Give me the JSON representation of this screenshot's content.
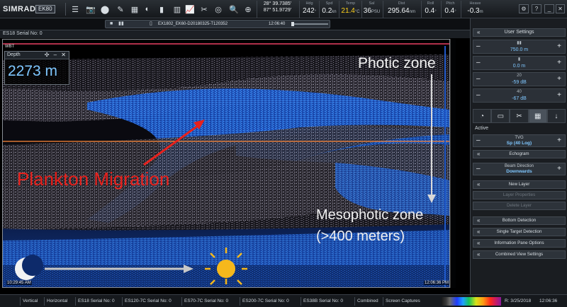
{
  "app": {
    "brand": "SIMRAD",
    "model": "EK80"
  },
  "toolbar": {
    "icons": [
      "camera-icon",
      "record-icon",
      "pen-icon",
      "palette-icon",
      "gauge-icon",
      "bar-chart-icon",
      "graph-icon",
      "tools-icon",
      "magnifier-icon",
      "list-icon",
      "grid-icon"
    ],
    "position": {
      "lat": "28° 39.7385'",
      "lon": "87° 51.9729'"
    },
    "readouts": [
      {
        "label": "Hdg",
        "value": "242",
        "unit": "°"
      },
      {
        "label": "Spd",
        "value": "0.2",
        "unit": "kn"
      },
      {
        "label": "Temp",
        "value": "21.4",
        "unit": "°C",
        "accent": "#ffd21a"
      },
      {
        "label": "Sal",
        "value": "36",
        "unit": "PSU"
      },
      {
        "label": "Dist",
        "value": "295.64",
        "unit": "nm"
      },
      {
        "label": "Roll",
        "value": "0.4",
        "unit": "°"
      },
      {
        "label": "Pitch",
        "value": "0.4",
        "unit": "°"
      },
      {
        "label": "Heave",
        "value": "-0.3",
        "unit": "m"
      }
    ]
  },
  "replay": {
    "filename": "EX1802_EK60-D20180325-T120352",
    "time": "12:06:40"
  },
  "echogram": {
    "window_title": "ES18 Serial No: 0",
    "wst_label": "WBT",
    "depth_panel": {
      "title": "Depth",
      "value": "2273 m"
    },
    "annotations": {
      "photic": "Photic zone",
      "plankton": "Plankton Migration",
      "meso_line1": "Mesophotic zone",
      "meso_line2": "(>400 meters)"
    },
    "time_left": "10:29:45 AM",
    "time_right": "12:06:36 PM"
  },
  "user_settings": {
    "title": "User Settings",
    "range": "750.0 m",
    "start": "0.0 m",
    "gain1_label": "20",
    "gain1": "-59 dB",
    "gain2_label": "40",
    "gain2": "-67 dB"
  },
  "active_panel": {
    "label": "Active",
    "tvg_label": "TVG",
    "tvg_value": "Sp (40 Log)",
    "echogram": "Echogram",
    "beam_label": "Beam Direction",
    "beam_value": "Downwards",
    "new_layer": "New Layer",
    "layer_properties": "Layer Properties",
    "delete_layer": "Delete Layer",
    "bottom_detection": "Bottom Detection",
    "single_target": "Single Target Detection",
    "info_pane": "Information Pane Options",
    "combined_view": "Combined View Settings"
  },
  "statusbar": {
    "items": [
      "Vertical",
      "Horizontal",
      "ES18 Serial No: 0",
      "ES120-7C Serial No: 0",
      "ES70-7C Serial No: 0",
      "ES200-7C Serial No: 0",
      "ES38B Serial No: 0",
      "Combined",
      "Screen Captures"
    ],
    "date": "R: 3/25/2018",
    "clock": "12:06:36"
  }
}
